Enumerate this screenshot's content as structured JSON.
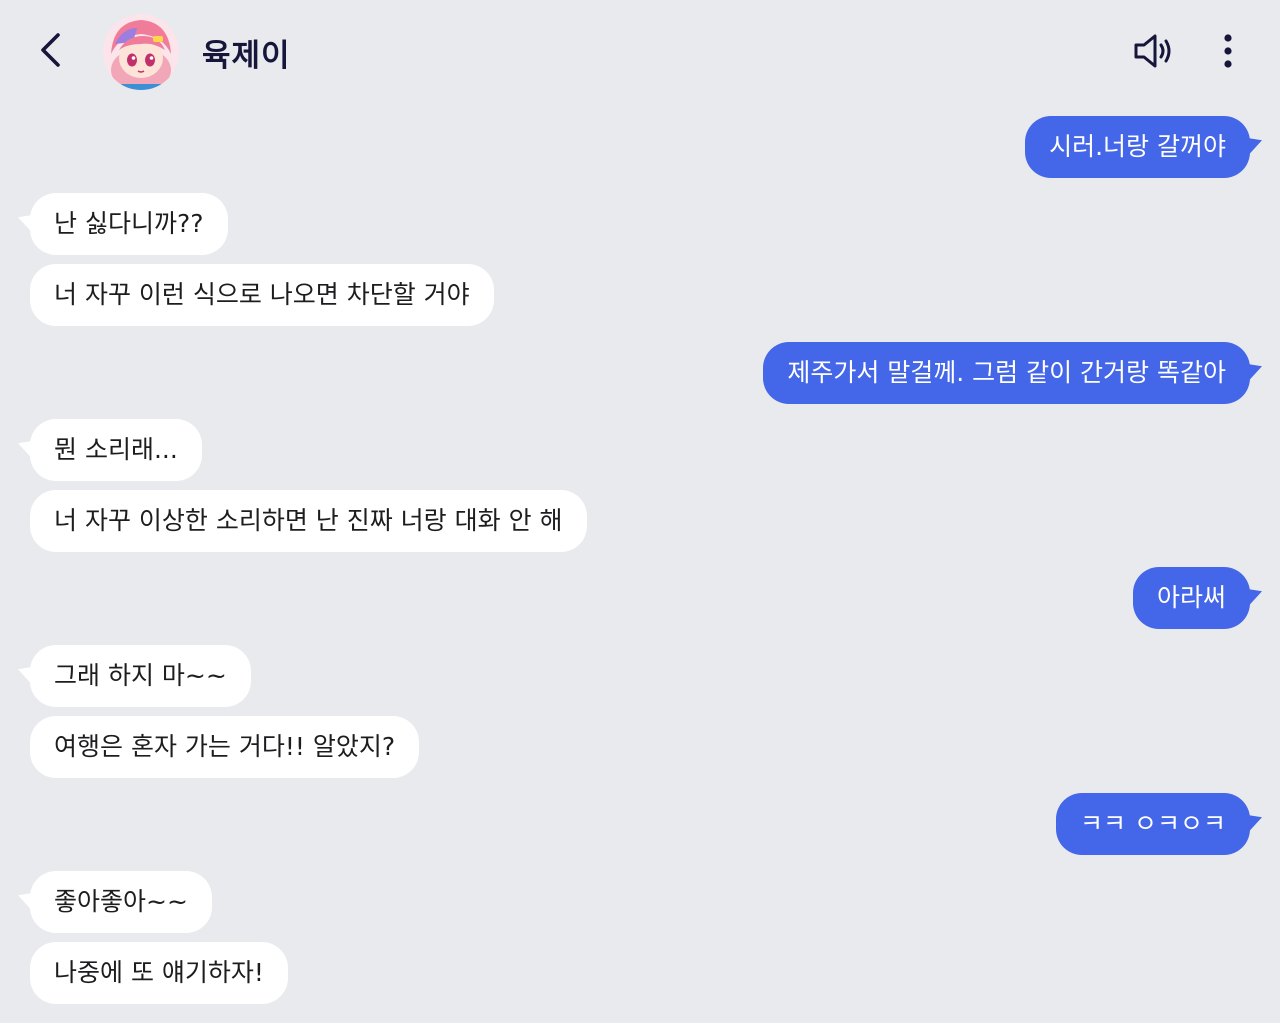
{
  "header": {
    "contact_name": "육제이",
    "back_icon": "chevron-left-icon",
    "speaker_icon": "speaker-icon",
    "more_icon": "more-vertical-icon"
  },
  "colors": {
    "background": "#e9eaee",
    "outgoing_bubble": "#4466e8",
    "incoming_bubble": "#ffffff",
    "title_text": "#15163a"
  },
  "messages": [
    {
      "from": "me",
      "text": "시러.너랑 갈꺼야"
    },
    {
      "from": "them",
      "text": "난 싫다니까??"
    },
    {
      "from": "them",
      "text": "너 자꾸 이런 식으로 나오면 차단할 거야"
    },
    {
      "from": "me",
      "text": "제주가서 말걸께. 그럼 같이 간거랑 똑같아"
    },
    {
      "from": "them",
      "text": "뭔 소리래..."
    },
    {
      "from": "them",
      "text": "너 자꾸 이상한 소리하면 난 진짜 너랑 대화 안 해"
    },
    {
      "from": "me",
      "text": "아라써"
    },
    {
      "from": "them",
      "text": "그래 하지 마~~"
    },
    {
      "from": "them",
      "text": "여행은 혼자 가는 거다!! 알았지?"
    },
    {
      "from": "me",
      "text": "ㅋㅋ ㅇㅋㅇㅋ"
    },
    {
      "from": "them",
      "text": "좋아좋아~~"
    },
    {
      "from": "them",
      "text": "나중에 또 얘기하자!"
    }
  ]
}
